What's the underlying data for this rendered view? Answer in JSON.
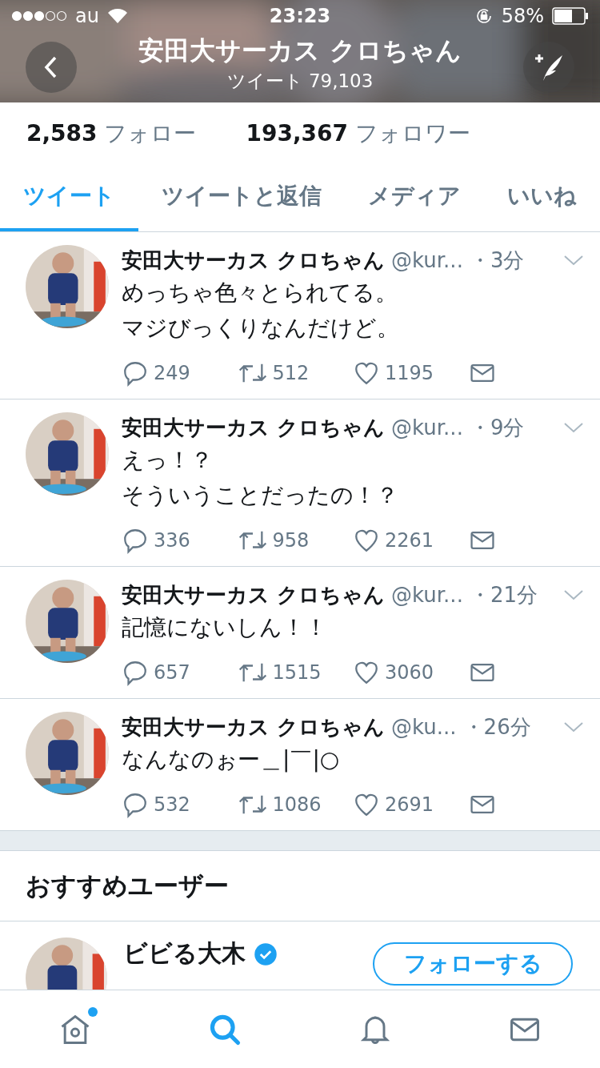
{
  "status_bar": {
    "carrier": "au",
    "time": "23:23",
    "battery": "58%"
  },
  "header": {
    "title": "安田大サーカス クロちゃん",
    "subtitle": "ツイート 79,103"
  },
  "stats": [
    {
      "count": "2,583",
      "label": "フォロー"
    },
    {
      "count": "193,367",
      "label": "フォロワー"
    }
  ],
  "tabs": [
    {
      "label": "ツイート",
      "selected": true
    },
    {
      "label": "ツイートと返信",
      "selected": false
    },
    {
      "label": "メディア",
      "selected": false
    },
    {
      "label": "いいね",
      "selected": false
    }
  ],
  "tweets": [
    {
      "name": "安田大サーカス クロちゃん",
      "handle": "@kur...",
      "time": "・3分",
      "lines": [
        "めっちゃ色々とられてる。",
        "マジびっくりなんだけど。"
      ],
      "replies": "249",
      "retweets": "512",
      "likes": "1195"
    },
    {
      "name": "安田大サーカス クロちゃん",
      "handle": "@kur...",
      "time": "・9分",
      "lines": [
        "えっ！？",
        "そういうことだったの！？"
      ],
      "replies": "336",
      "retweets": "958",
      "likes": "2261"
    },
    {
      "name": "安田大サーカス クロちゃん",
      "handle": "@kur...",
      "time": "・21分",
      "lines": [
        "記憶にないしん！！"
      ],
      "replies": "657",
      "retweets": "1515",
      "likes": "3060"
    },
    {
      "name": "安田大サーカス クロちゃん",
      "handle": "@ku...",
      "time": "・26分",
      "lines": [
        "なんなのぉー＿|￣|○"
      ],
      "replies": "532",
      "retweets": "1086",
      "likes": "2691"
    }
  ],
  "suggestions": {
    "title": "おすすめユーザー",
    "users": [
      {
        "name": "ビビる大木",
        "verified": true,
        "button": "フォローする"
      }
    ]
  },
  "tab_bar": [
    {
      "kind": "home",
      "selected": false,
      "badge": true
    },
    {
      "kind": "search",
      "selected": true,
      "badge": false
    },
    {
      "kind": "notifications",
      "selected": false,
      "badge": false
    },
    {
      "kind": "messages",
      "selected": false,
      "badge": false
    }
  ]
}
